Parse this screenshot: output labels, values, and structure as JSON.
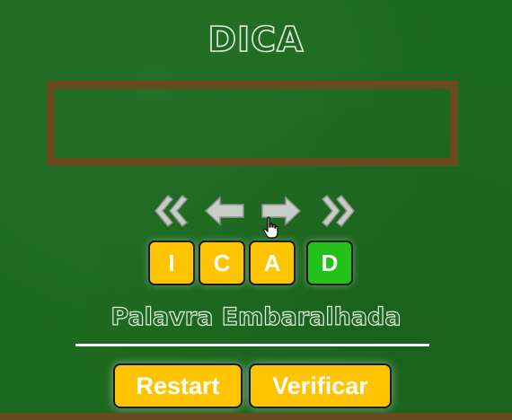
{
  "title": "DICA",
  "hint": {
    "text": ""
  },
  "nav": {
    "first_icon": "double-chevron-left-icon",
    "prev_icon": "arrow-left-icon",
    "next_icon": "arrow-right-icon",
    "last_icon": "double-chevron-right-icon"
  },
  "tiles": [
    {
      "letter": "I",
      "color": "#ffc400"
    },
    {
      "letter": "C",
      "color": "#ffc400"
    },
    {
      "letter": "A",
      "color": "#ffc400"
    },
    {
      "letter": "D",
      "color": "#22c21a"
    }
  ],
  "word_label": "Palavra Embaralhada",
  "buttons": {
    "restart": "Restart",
    "verify": "Verificar"
  },
  "colors": {
    "board": "#1c6a1f",
    "frame": "#6b4a1f",
    "tile_default": "#ffc400",
    "tile_correct": "#22c21a",
    "chalk": "#e6eee0"
  }
}
